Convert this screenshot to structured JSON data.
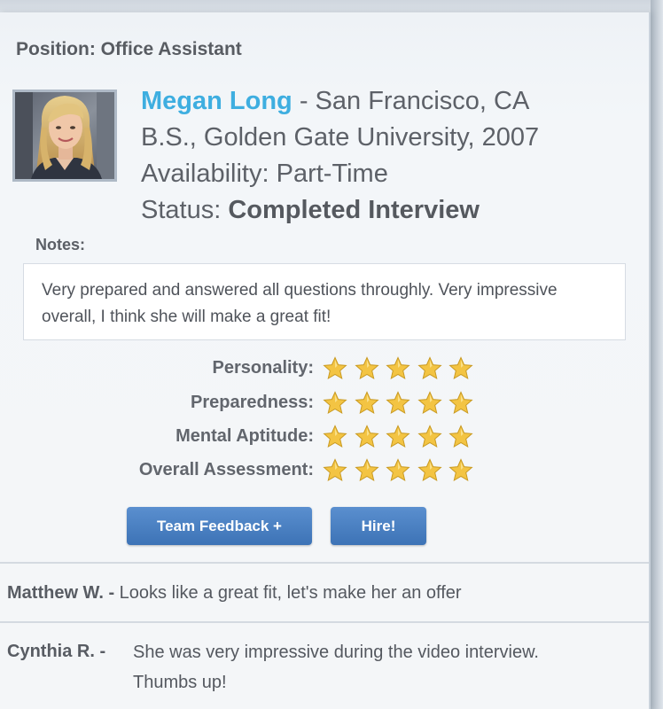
{
  "header": {
    "position_label": "Position:",
    "position_value": "Office Assistant"
  },
  "candidate": {
    "name": "Megan Long",
    "name_separator": " - ",
    "location": "San Francisco, CA",
    "education": "B.S., Golden Gate University, 2007",
    "availability_label": "Availability:",
    "availability_value": "Part-Time",
    "status_label": "Status:",
    "status_value": "Completed Interview"
  },
  "notes": {
    "label": "Notes:",
    "text": "Very prepared and answered all questions throughly.  Very impressive overall, I think she will make a great fit!"
  },
  "ratings": [
    {
      "label": "Personality:",
      "stars": 5,
      "max": 5
    },
    {
      "label": "Preparedness:",
      "stars": 5,
      "max": 5
    },
    {
      "label": "Mental Aptitude:",
      "stars": 5,
      "max": 5
    },
    {
      "label": "Overall Assessment:",
      "stars": 5,
      "max": 5
    }
  ],
  "buttons": {
    "team_feedback": "Team Feedback +",
    "hire": "Hire!"
  },
  "feedback": [
    {
      "author": "Matthew W. -",
      "text": "Looks like a great fit, let's make her an offer"
    },
    {
      "author": "Cynthia R. -",
      "text_line1": "She was very impressive during the video interview.",
      "text_line2": "Thumbs up!"
    }
  ],
  "colors": {
    "accent_name": "#3eaee0",
    "button": "#4a80c3",
    "star": "#f3c443"
  },
  "icons": {
    "rating_star": "star-icon"
  }
}
